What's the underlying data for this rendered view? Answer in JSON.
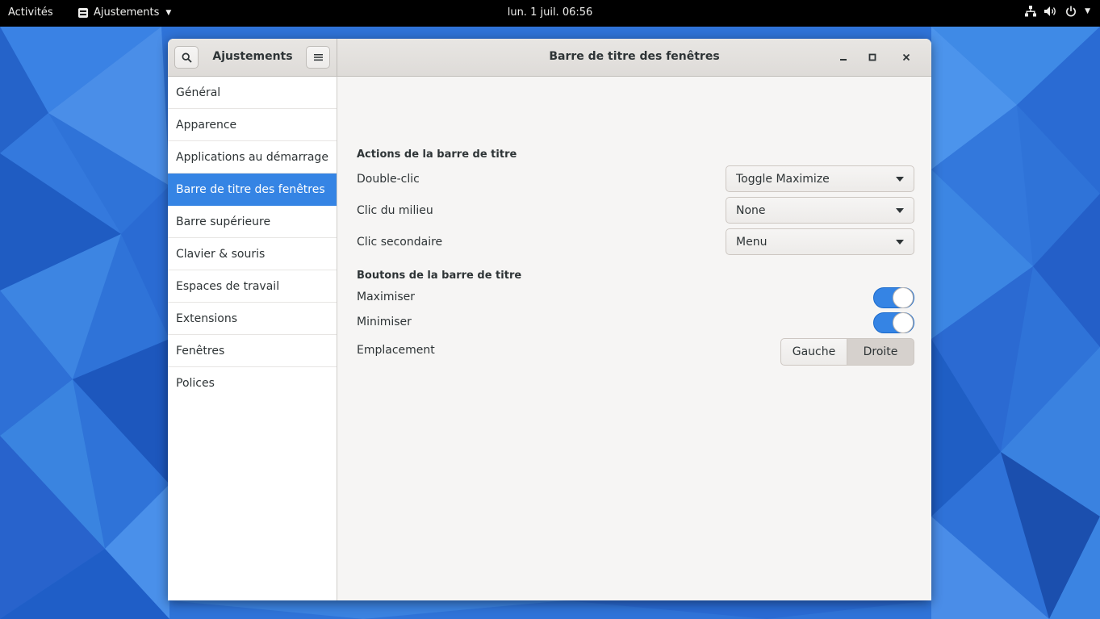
{
  "topbar": {
    "activities": "Activités",
    "app_name": "Ajustements",
    "clock": "lun. 1 juil.  06:56",
    "icons": [
      "network-icon",
      "volume-icon",
      "power-icon",
      "chevron-down-icon"
    ]
  },
  "window": {
    "sidebar_title": "Ajustements",
    "title": "Barre de titre des fenêtres"
  },
  "sidebar": {
    "items": [
      {
        "label": "Général"
      },
      {
        "label": "Apparence"
      },
      {
        "label": "Applications au démarrage"
      },
      {
        "label": "Barre de titre des fenêtres",
        "selected": true
      },
      {
        "label": "Barre supérieure"
      },
      {
        "label": "Clavier & souris"
      },
      {
        "label": "Espaces de travail"
      },
      {
        "label": "Extensions"
      },
      {
        "label": "Fenêtres"
      },
      {
        "label": "Polices"
      }
    ]
  },
  "content": {
    "actions_title": "Actions de la barre de titre",
    "double_click": {
      "label": "Double-clic",
      "value": "Toggle Maximize"
    },
    "middle_click": {
      "label": "Clic du milieu",
      "value": "None"
    },
    "secondary_click": {
      "label": "Clic secondaire",
      "value": "Menu"
    },
    "buttons_title": "Boutons de la barre de titre",
    "maximize": {
      "label": "Maximiser",
      "on": true
    },
    "minimize": {
      "label": "Minimiser",
      "on": true
    },
    "placement": {
      "label": "Emplacement",
      "left": "Gauche",
      "right": "Droite",
      "selected": "Droite"
    }
  },
  "colors": {
    "accent": "#3584e4",
    "desktop_blue": "#2a6fd6",
    "topbar": "#000000"
  }
}
